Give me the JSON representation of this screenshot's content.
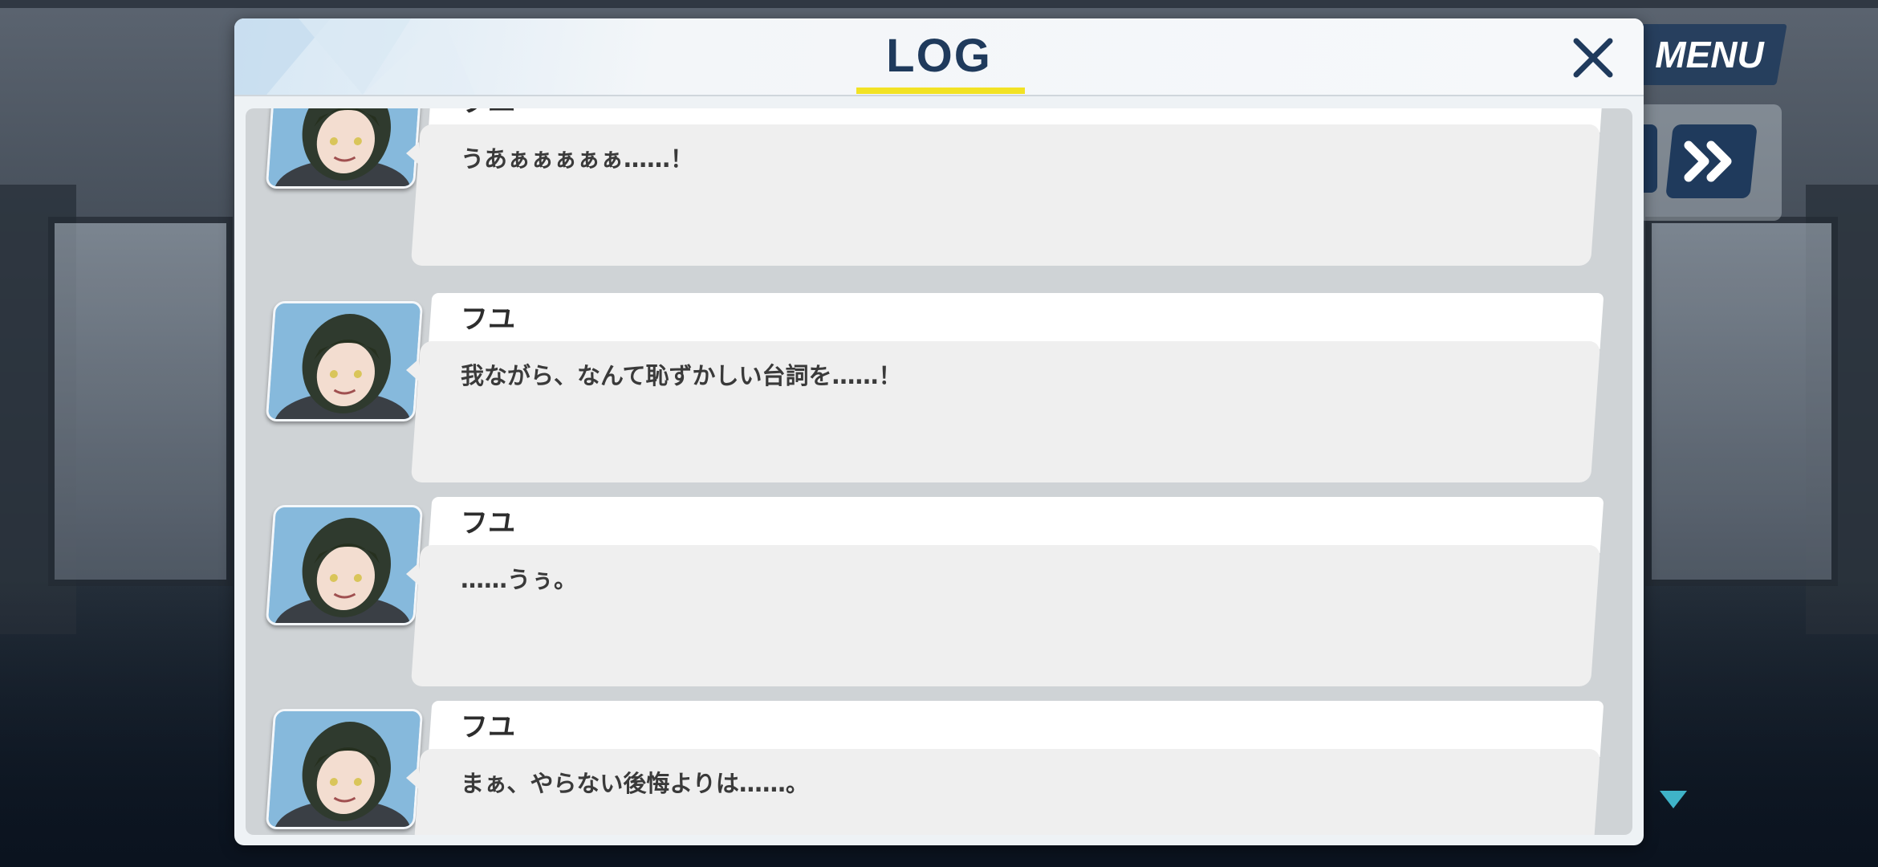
{
  "dialog": {
    "title": "LOG",
    "close_icon": "close-icon",
    "accent_color": "#f2e224",
    "title_color": "#1f3a5c"
  },
  "controls": {
    "menu_label": "MENU",
    "fast_forward_icon": "fast-forward-icon",
    "continue_icon": "triangle-down-icon"
  },
  "entries": [
    {
      "speaker": "フユ",
      "text": "うあぁぁぁぁぁ……！"
    },
    {
      "speaker": "フユ",
      "text": "我ながら、なんて恥ずかしい台詞を……！"
    },
    {
      "speaker": "フユ",
      "text": "……うぅ。"
    },
    {
      "speaker": "フユ",
      "text": "まぁ、やらない後悔よりは……。"
    }
  ]
}
